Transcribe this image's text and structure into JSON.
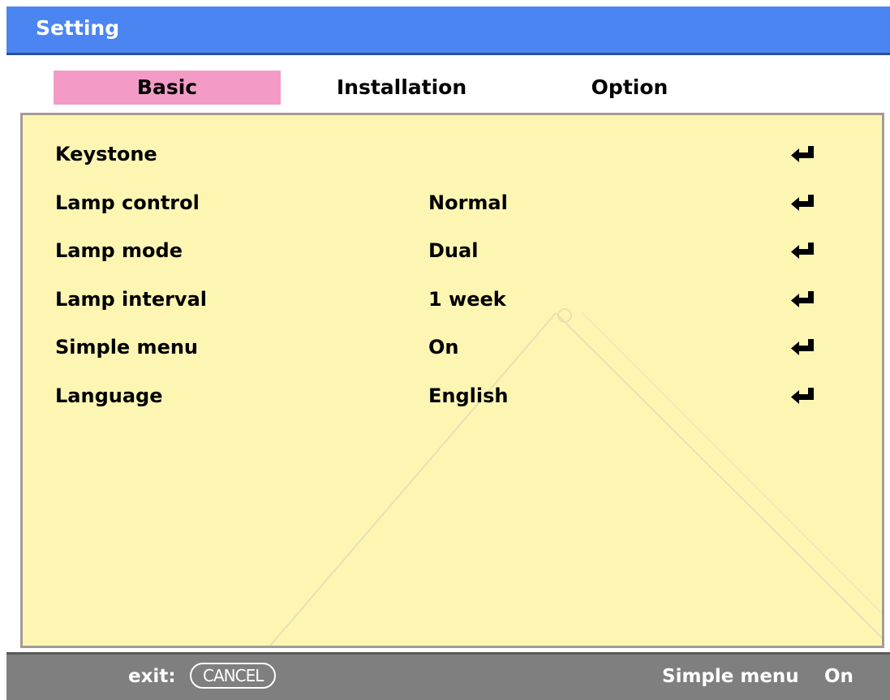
{
  "window": {
    "title": "Setting"
  },
  "tabs": [
    {
      "label": "Basic",
      "active": true
    },
    {
      "label": "Installation",
      "active": false
    },
    {
      "label": "Option",
      "active": false
    }
  ],
  "menu": [
    {
      "label": "Keystone",
      "value": "",
      "icon": "enter-arrow-icon"
    },
    {
      "label": "Lamp control",
      "value": "Normal",
      "icon": "enter-arrow-icon"
    },
    {
      "label": "Lamp mode",
      "value": "Dual",
      "icon": "enter-arrow-icon"
    },
    {
      "label": "Lamp interval",
      "value": "1 week",
      "icon": "enter-arrow-icon"
    },
    {
      "label": "Simple menu",
      "value": "On",
      "icon": "enter-arrow-icon"
    },
    {
      "label": "Language",
      "value": "English",
      "icon": "enter-arrow-icon"
    }
  ],
  "status": {
    "exit_label": "exit:",
    "cancel_key": "CANCEL",
    "simple_menu_label": "Simple menu",
    "simple_menu_value": "On"
  },
  "colors": {
    "titlebar": "#4b85f2",
    "active_tab": "#f39bc6",
    "panel": "#fdf6b3",
    "panel_border": "#a49b95",
    "statusbar": "#7f7f7f"
  }
}
